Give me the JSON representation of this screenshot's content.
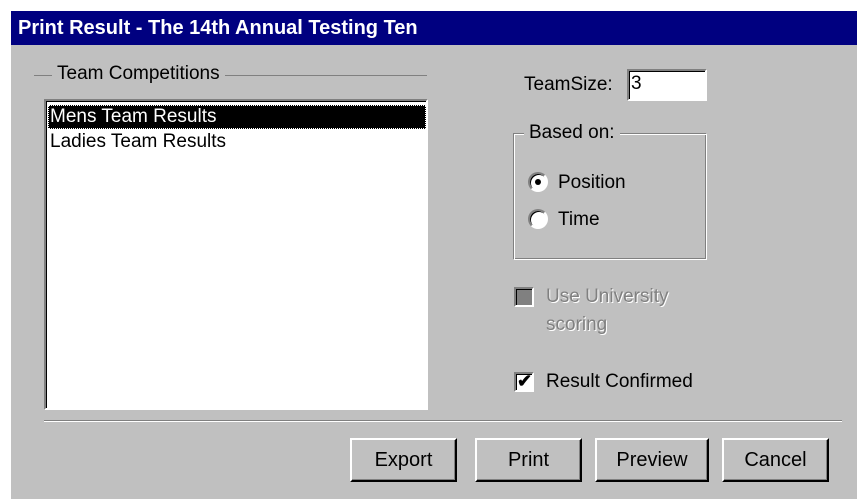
{
  "window": {
    "title": "Print Result - The 14th Annual Testing Ten"
  },
  "team_competitions": {
    "label": "Team Competitions",
    "items": [
      {
        "label": "Mens Team Results",
        "selected": true
      },
      {
        "label": "Ladies Team Results",
        "selected": false
      }
    ]
  },
  "team_size": {
    "label": "TeamSize:",
    "value": "3"
  },
  "based_on": {
    "label": "Based on:",
    "options": [
      {
        "label": "Position",
        "checked": true
      },
      {
        "label": "Time",
        "checked": false
      }
    ]
  },
  "university_scoring": {
    "line1": "Use University",
    "line2": "scoring",
    "enabled": false,
    "checked": false
  },
  "result_confirmed": {
    "label": "Result Confirmed",
    "checked": true
  },
  "buttons": {
    "export": "Export",
    "print": "Print",
    "preview": "Preview",
    "cancel": "Cancel"
  },
  "colors": {
    "face": "#c0c0c0",
    "title_bar": "#000080",
    "selection": "#000000"
  }
}
